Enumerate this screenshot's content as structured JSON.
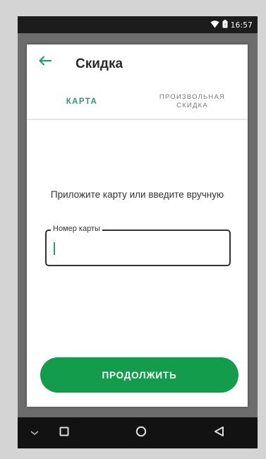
{
  "status_bar": {
    "time": "16:57",
    "icons": [
      "wifi-icon",
      "battery-icon"
    ]
  },
  "dialog": {
    "title": "Скидка",
    "back_icon": "back-arrow-icon",
    "tabs": [
      {
        "label": "КАРТА",
        "selected": true
      },
      {
        "label": "ПРОИЗВОЛЬНАЯ СКИДКА",
        "selected": false
      }
    ],
    "prompt": "Приложите карту или введите вручную",
    "card_field": {
      "label": "Номер карты",
      "value": ""
    },
    "continue_label": "ПРОДОЛЖИТЬ"
  },
  "nav_bar": {
    "icons": [
      "keyboard-hide-icon",
      "recents-icon",
      "home-icon",
      "back-icon"
    ]
  },
  "colors": {
    "accent": "#2e9a70",
    "button": "#129c4c",
    "background": "#d4d4d4"
  }
}
